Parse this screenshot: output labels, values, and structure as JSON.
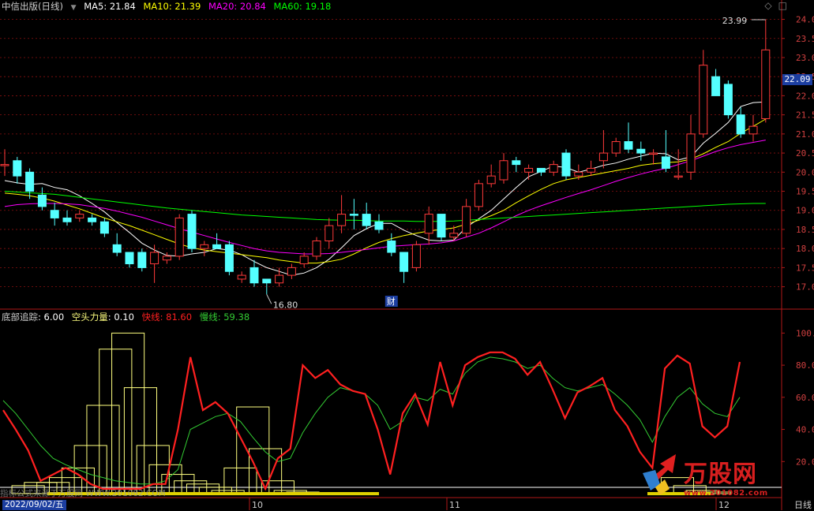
{
  "header": {
    "title": "中信出版(日线)",
    "ma5": "MA5: 21.84",
    "ma10": "MA10: 21.39",
    "ma20": "MA20: 20.84",
    "ma60": "MA60: 19.18",
    "colors": {
      "title": "#cfcfcf",
      "ma5": "#ffffff",
      "ma10": "#ffff00",
      "ma20": "#ff00ff",
      "ma60": "#00ff00"
    }
  },
  "indicator_header": {
    "name": "底部追踪",
    "value": ": 6.00",
    "bear_label": "空头力量",
    "bear_value": ": 0.10",
    "fast_label": "快线",
    "fast_value": ": 81.60",
    "slow_label": "慢线",
    "slow_value": ": 59.38"
  },
  "price_badge": "22.09",
  "date_badge": "2022/09/02/五",
  "period_label": "日线",
  "watermark": {
    "text": "指标公式来源于万股网 WWW.201082.COM",
    "logo_word": "万股网",
    "logo_url": "www.201082.com"
  },
  "icons": [
    "diamond-icon",
    "fullscreen-icon"
  ],
  "chart_data": [
    {
      "type": "candlestick",
      "title": "中信出版(日线)",
      "ylim": [
        16.6,
        24.3
      ],
      "y_ticks": [
        "24.0",
        "23.5",
        "23.0",
        "22.5",
        "22.0",
        "21.5",
        "21.0",
        "20.5",
        "20.0",
        "19.5",
        "19.0",
        "18.5",
        "18.0",
        "17.5",
        "17.0"
      ],
      "x_ticks": [
        "10",
        "11",
        "12"
      ],
      "annotations": {
        "high": "23.99",
        "low": "16.80",
        "event": "财"
      },
      "candles": [
        {
          "o": 20.2,
          "h": 20.6,
          "l": 19.9,
          "c": 20.2,
          "d": "up"
        },
        {
          "o": 20.3,
          "h": 20.4,
          "l": 19.7,
          "c": 19.9,
          "d": "down"
        },
        {
          "o": 20.0,
          "h": 20.1,
          "l": 19.3,
          "c": 19.5,
          "d": "down"
        },
        {
          "o": 19.4,
          "h": 19.6,
          "l": 19.0,
          "c": 19.1,
          "d": "down"
        },
        {
          "o": 19.0,
          "h": 19.2,
          "l": 18.6,
          "c": 18.8,
          "d": "down"
        },
        {
          "o": 18.8,
          "h": 19.0,
          "l": 18.6,
          "c": 18.7,
          "d": "down"
        },
        {
          "o": 18.8,
          "h": 19.0,
          "l": 18.7,
          "c": 18.9,
          "d": "up"
        },
        {
          "o": 18.8,
          "h": 18.9,
          "l": 18.6,
          "c": 18.7,
          "d": "down"
        },
        {
          "o": 18.7,
          "h": 18.8,
          "l": 18.3,
          "c": 18.4,
          "d": "down"
        },
        {
          "o": 18.1,
          "h": 18.4,
          "l": 17.8,
          "c": 17.9,
          "d": "down"
        },
        {
          "o": 17.9,
          "h": 17.9,
          "l": 17.5,
          "c": 17.6,
          "d": "down"
        },
        {
          "o": 17.9,
          "h": 18.0,
          "l": 17.4,
          "c": 17.5,
          "d": "down"
        },
        {
          "o": 17.6,
          "h": 18.1,
          "l": 17.1,
          "c": 17.9,
          "d": "up"
        },
        {
          "o": 17.8,
          "h": 17.9,
          "l": 17.6,
          "c": 17.7,
          "d": "up"
        },
        {
          "o": 17.8,
          "h": 18.9,
          "l": 17.7,
          "c": 18.8,
          "d": "up"
        },
        {
          "o": 18.9,
          "h": 19.0,
          "l": 17.9,
          "c": 18.0,
          "d": "down"
        },
        {
          "o": 18.0,
          "h": 18.2,
          "l": 17.8,
          "c": 18.1,
          "d": "up"
        },
        {
          "o": 18.1,
          "h": 18.4,
          "l": 18.0,
          "c": 18.0,
          "d": "down"
        },
        {
          "o": 18.1,
          "h": 18.2,
          "l": 17.3,
          "c": 17.4,
          "d": "down"
        },
        {
          "o": 17.3,
          "h": 17.4,
          "l": 17.1,
          "c": 17.2,
          "d": "up"
        },
        {
          "o": 17.5,
          "h": 17.7,
          "l": 17.0,
          "c": 17.1,
          "d": "down"
        },
        {
          "o": 17.2,
          "h": 17.2,
          "l": 16.8,
          "c": 17.1,
          "d": "down"
        },
        {
          "o": 17.1,
          "h": 17.5,
          "l": 17.0,
          "c": 17.3,
          "d": "up"
        },
        {
          "o": 17.3,
          "h": 17.6,
          "l": 17.2,
          "c": 17.5,
          "d": "up"
        },
        {
          "o": 17.6,
          "h": 17.9,
          "l": 17.5,
          "c": 17.8,
          "d": "up"
        },
        {
          "o": 17.8,
          "h": 18.3,
          "l": 17.7,
          "c": 18.2,
          "d": "up"
        },
        {
          "o": 18.2,
          "h": 18.8,
          "l": 18.0,
          "c": 18.6,
          "d": "up"
        },
        {
          "o": 18.6,
          "h": 19.4,
          "l": 18.4,
          "c": 18.9,
          "d": "up"
        },
        {
          "o": 18.9,
          "h": 19.3,
          "l": 18.5,
          "c": 18.9,
          "d": "down"
        },
        {
          "o": 18.9,
          "h": 19.2,
          "l": 18.5,
          "c": 18.6,
          "d": "down"
        },
        {
          "o": 18.7,
          "h": 18.9,
          "l": 18.4,
          "c": 18.5,
          "d": "down"
        },
        {
          "o": 18.2,
          "h": 18.4,
          "l": 17.8,
          "c": 17.9,
          "d": "down"
        },
        {
          "o": 17.9,
          "h": 17.9,
          "l": 17.1,
          "c": 17.4,
          "d": "down"
        },
        {
          "o": 17.5,
          "h": 18.2,
          "l": 17.4,
          "c": 18.1,
          "d": "up"
        },
        {
          "o": 18.4,
          "h": 19.1,
          "l": 18.1,
          "c": 18.9,
          "d": "up"
        },
        {
          "o": 18.9,
          "h": 18.9,
          "l": 18.2,
          "c": 18.3,
          "d": "down"
        },
        {
          "o": 18.3,
          "h": 18.6,
          "l": 18.2,
          "c": 18.4,
          "d": "up"
        },
        {
          "o": 18.4,
          "h": 19.3,
          "l": 18.3,
          "c": 19.1,
          "d": "up"
        },
        {
          "o": 19.1,
          "h": 19.8,
          "l": 19.0,
          "c": 19.7,
          "d": "up"
        },
        {
          "o": 19.7,
          "h": 20.2,
          "l": 19.6,
          "c": 19.9,
          "d": "up"
        },
        {
          "o": 19.8,
          "h": 20.5,
          "l": 19.7,
          "c": 20.3,
          "d": "up"
        },
        {
          "o": 20.3,
          "h": 20.4,
          "l": 20.0,
          "c": 20.2,
          "d": "down"
        },
        {
          "o": 20.0,
          "h": 20.2,
          "l": 19.8,
          "c": 20.1,
          "d": "up"
        },
        {
          "o": 20.1,
          "h": 20.1,
          "l": 19.9,
          "c": 20.0,
          "d": "down"
        },
        {
          "o": 20.0,
          "h": 20.3,
          "l": 19.9,
          "c": 20.2,
          "d": "up"
        },
        {
          "o": 20.5,
          "h": 20.6,
          "l": 19.8,
          "c": 19.9,
          "d": "down"
        },
        {
          "o": 19.9,
          "h": 20.2,
          "l": 19.8,
          "c": 20.0,
          "d": "up"
        },
        {
          "o": 20.0,
          "h": 20.3,
          "l": 19.9,
          "c": 20.1,
          "d": "up"
        },
        {
          "o": 20.3,
          "h": 21.1,
          "l": 20.1,
          "c": 20.5,
          "d": "up"
        },
        {
          "o": 20.5,
          "h": 20.9,
          "l": 20.4,
          "c": 20.8,
          "d": "up"
        },
        {
          "o": 20.8,
          "h": 21.3,
          "l": 20.5,
          "c": 20.6,
          "d": "down"
        },
        {
          "o": 20.6,
          "h": 20.8,
          "l": 20.3,
          "c": 20.5,
          "d": "down"
        },
        {
          "o": 20.5,
          "h": 20.6,
          "l": 20.2,
          "c": 20.5,
          "d": "up"
        },
        {
          "o": 20.4,
          "h": 21.1,
          "l": 20.0,
          "c": 20.1,
          "d": "down"
        },
        {
          "o": 19.9,
          "h": 20.6,
          "l": 19.8,
          "c": 19.9,
          "d": "up"
        },
        {
          "o": 20.0,
          "h": 21.5,
          "l": 19.8,
          "c": 21.0,
          "d": "up"
        },
        {
          "o": 21.0,
          "h": 23.2,
          "l": 20.9,
          "c": 22.8,
          "d": "up"
        },
        {
          "o": 22.5,
          "h": 22.7,
          "l": 22.0,
          "c": 22.0,
          "d": "down"
        },
        {
          "o": 22.3,
          "h": 22.4,
          "l": 21.4,
          "c": 21.5,
          "d": "down"
        },
        {
          "o": 21.5,
          "h": 21.7,
          "l": 20.9,
          "c": 21.0,
          "d": "down"
        },
        {
          "o": 21.0,
          "h": 21.5,
          "l": 20.8,
          "c": 21.2,
          "d": "up"
        },
        {
          "o": 21.4,
          "h": 23.99,
          "l": 21.3,
          "c": 23.2,
          "d": "up"
        }
      ],
      "series": [
        {
          "name": "MA5",
          "color": "#ffffff",
          "values": [
            19.78,
            19.72,
            19.68,
            19.7,
            19.6,
            19.54,
            19.38,
            19.18,
            18.96,
            18.68,
            18.42,
            18.14,
            17.96,
            17.82,
            17.8,
            17.86,
            17.9,
            18.0,
            17.96,
            17.84,
            17.66,
            17.5,
            17.4,
            17.3,
            17.36,
            17.5,
            17.72,
            18.02,
            18.34,
            18.52,
            18.66,
            18.66,
            18.48,
            18.34,
            18.22,
            18.2,
            18.22,
            18.56,
            18.78,
            19.0,
            19.3,
            19.6,
            19.88,
            20.02,
            20.16,
            20.12,
            20.0,
            20.08,
            20.18,
            20.24,
            20.34,
            20.42,
            20.5,
            20.48,
            20.32,
            20.4,
            20.76,
            21.02,
            21.3,
            21.72,
            21.82,
            21.84
          ]
        },
        {
          "name": "MA10",
          "color": "#ffff00",
          "values": [
            19.45,
            19.42,
            19.38,
            19.32,
            19.24,
            19.14,
            19.04,
            18.92,
            18.8,
            18.7,
            18.6,
            18.48,
            18.36,
            18.24,
            18.12,
            18.02,
            17.96,
            17.92,
            17.88,
            17.84,
            17.8,
            17.76,
            17.7,
            17.66,
            17.62,
            17.62,
            17.66,
            17.72,
            17.86,
            18.02,
            18.16,
            18.26,
            18.34,
            18.4,
            18.46,
            18.5,
            18.54,
            18.64,
            18.74,
            18.86,
            19.0,
            19.2,
            19.38,
            19.55,
            19.7,
            19.8,
            19.86,
            19.92,
            19.98,
            20.04,
            20.1,
            20.18,
            20.22,
            20.25,
            20.27,
            20.34,
            20.48,
            20.65,
            20.8,
            21.02,
            21.2,
            21.39
          ]
        },
        {
          "name": "MA20",
          "color": "#ff00ff",
          "values": [
            19.1,
            19.15,
            19.17,
            19.18,
            19.18,
            19.17,
            19.15,
            19.1,
            19.05,
            18.98,
            18.9,
            18.82,
            18.72,
            18.62,
            18.52,
            18.43,
            18.34,
            18.25,
            18.16,
            18.08,
            18.0,
            17.94,
            17.9,
            17.88,
            17.86,
            17.86,
            17.87,
            17.9,
            17.94,
            17.98,
            18.02,
            18.06,
            18.08,
            18.1,
            18.12,
            18.15,
            18.2,
            18.3,
            18.4,
            18.54,
            18.7,
            18.86,
            19.0,
            19.12,
            19.23,
            19.34,
            19.44,
            19.54,
            19.65,
            19.76,
            19.86,
            19.95,
            20.03,
            20.1,
            20.2,
            20.3,
            20.42,
            20.54,
            20.64,
            20.72,
            20.78,
            20.84
          ]
        },
        {
          "name": "MA60",
          "color": "#00ff00",
          "values": [
            19.5,
            19.48,
            19.46,
            19.44,
            19.42,
            19.38,
            19.34,
            19.3,
            19.26,
            19.22,
            19.18,
            19.14,
            19.1,
            19.06,
            19.03,
            19.0,
            18.97,
            18.94,
            18.91,
            18.88,
            18.86,
            18.84,
            18.82,
            18.8,
            18.78,
            18.76,
            18.75,
            18.74,
            18.74,
            18.73,
            18.72,
            18.72,
            18.72,
            18.71,
            18.71,
            18.71,
            18.72,
            18.74,
            18.76,
            18.78,
            18.8,
            18.82,
            18.84,
            18.86,
            18.88,
            18.9,
            18.92,
            18.94,
            18.96,
            18.98,
            19.0,
            19.02,
            19.04,
            19.06,
            19.08,
            19.1,
            19.12,
            19.14,
            19.16,
            19.17,
            19.18,
            19.18
          ]
        }
      ]
    },
    {
      "type": "line",
      "title": "底部追踪",
      "ylim": [
        0,
        110
      ],
      "y_ticks": [
        "100.",
        "80.00",
        "60.00",
        "40.00",
        "20.00"
      ],
      "series": [
        {
          "name": "快线",
          "color": "#ff2020",
          "values": [
            52,
            40,
            27,
            8,
            12,
            16,
            12,
            6,
            3,
            3,
            3,
            3,
            6,
            6,
            40,
            85,
            52,
            57,
            50,
            35,
            20,
            3,
            22,
            28,
            80,
            72,
            77,
            68,
            64,
            62,
            40,
            12,
            50,
            62,
            43,
            82,
            55,
            80,
            85,
            88,
            88,
            84,
            74,
            82,
            65,
            47,
            63,
            67,
            72,
            52,
            42,
            26,
            16,
            78,
            86,
            81,
            42,
            35,
            42,
            82
          ]
        },
        {
          "name": "慢线",
          "color": "#33cc33",
          "values": [
            58,
            50,
            40,
            30,
            22,
            18,
            15,
            12,
            10,
            8,
            7,
            6,
            6,
            8,
            15,
            40,
            44,
            48,
            50,
            45,
            35,
            26,
            20,
            22,
            38,
            50,
            60,
            66,
            64,
            62,
            55,
            40,
            45,
            60,
            58,
            65,
            62,
            75,
            82,
            85,
            84,
            82,
            78,
            80,
            72,
            66,
            64,
            66,
            68,
            62,
            55,
            46,
            32,
            48,
            60,
            66,
            56,
            50,
            48,
            60
          ]
        },
        {
          "name": "底部追踪",
          "color": "#ffff80",
          "type": "bar",
          "values": [
            0,
            0,
            5,
            7,
            7,
            10,
            16,
            30,
            55,
            90,
            100,
            66,
            30,
            18,
            12,
            8,
            6,
            4,
            2,
            16,
            54,
            28,
            8,
            2,
            1,
            0,
            0,
            0,
            0,
            0,
            0,
            0,
            0,
            0,
            0,
            0,
            0,
            0,
            0,
            0,
            0,
            0,
            0,
            0,
            0,
            0,
            0,
            0,
            0,
            0,
            0,
            0,
            0,
            0,
            10,
            5,
            2,
            1,
            0,
            0
          ]
        }
      ]
    }
  ]
}
